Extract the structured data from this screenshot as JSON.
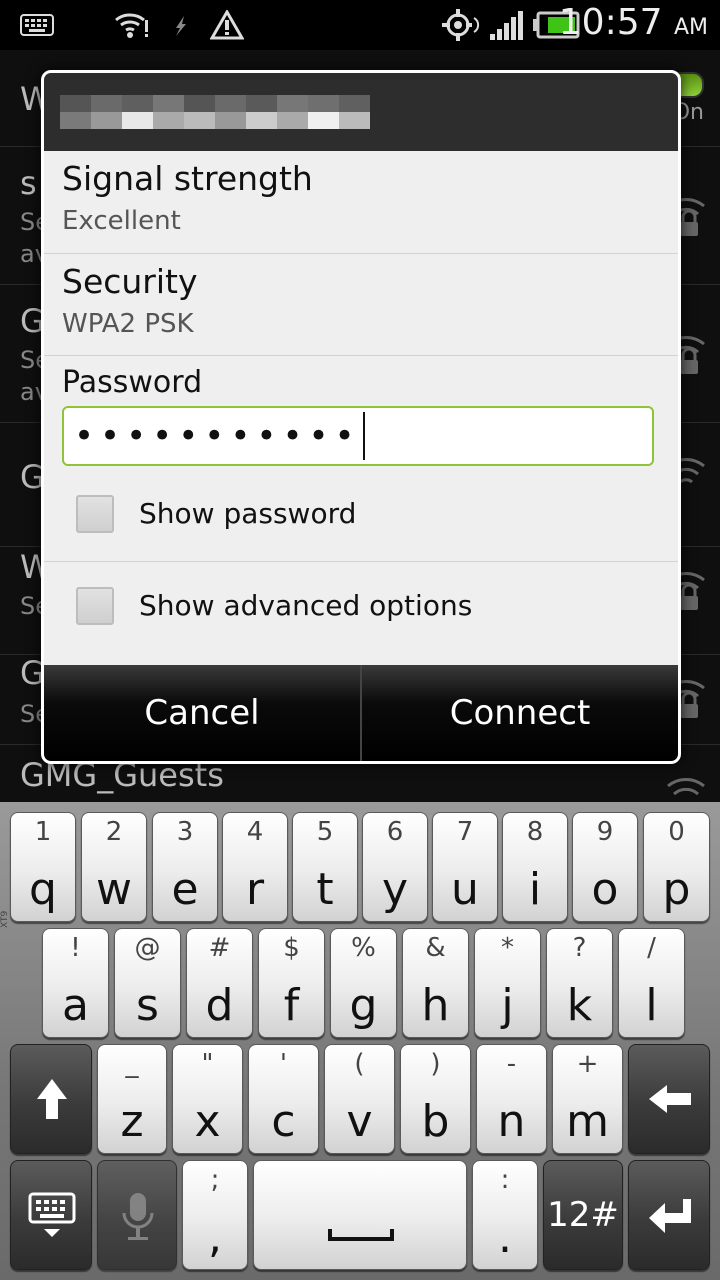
{
  "status_bar": {
    "time": "10:57",
    "ampm": "AM",
    "icons": [
      "keyboard-icon",
      "wifi-icon",
      "usb-debug-icon",
      "warning-icon",
      "gps-icon",
      "signal-icon",
      "battery-icon"
    ]
  },
  "background_list": {
    "toggle_label": "On",
    "rows": [
      {
        "ssid": "W",
        "sub": ""
      },
      {
        "ssid": "s",
        "sub": "Se",
        "sub2": "av"
      },
      {
        "ssid": "G",
        "sub": "Se",
        "sub2": "av"
      },
      {
        "ssid": "GM",
        "sub": ""
      },
      {
        "ssid": "W",
        "sub": "Se"
      },
      {
        "ssid": "G",
        "sub": "Se"
      },
      {
        "ssid": "GMG_Guests",
        "sub": ""
      }
    ]
  },
  "dialog": {
    "signal_label": "Signal strength",
    "signal_value": "Excellent",
    "security_label": "Security",
    "security_value": "WPA2 PSK",
    "password_label": "Password",
    "password_value": "•••••••••••",
    "show_password_label": "Show password",
    "show_advanced_label": "Show advanced options",
    "cancel_label": "Cancel",
    "connect_label": "Connect"
  },
  "keyboard": {
    "row1": [
      {
        "num": "1",
        "ch": "q"
      },
      {
        "num": "2",
        "ch": "w"
      },
      {
        "num": "3",
        "ch": "e"
      },
      {
        "num": "4",
        "ch": "r"
      },
      {
        "num": "5",
        "ch": "t"
      },
      {
        "num": "6",
        "ch": "y"
      },
      {
        "num": "7",
        "ch": "u"
      },
      {
        "num": "8",
        "ch": "i"
      },
      {
        "num": "9",
        "ch": "o"
      },
      {
        "num": "0",
        "ch": "p"
      }
    ],
    "row2": [
      {
        "num": "!",
        "ch": "a"
      },
      {
        "num": "@",
        "ch": "s"
      },
      {
        "num": "#",
        "ch": "d"
      },
      {
        "num": "$",
        "ch": "f"
      },
      {
        "num": "%",
        "ch": "g"
      },
      {
        "num": "&",
        "ch": "h"
      },
      {
        "num": "*",
        "ch": "j"
      },
      {
        "num": "?",
        "ch": "k"
      },
      {
        "num": "/",
        "ch": "l"
      }
    ],
    "row3": [
      {
        "num": "_",
        "ch": "z"
      },
      {
        "num": "\"",
        "ch": "x"
      },
      {
        "num": "'",
        "ch": "c"
      },
      {
        "num": "(",
        "ch": "v"
      },
      {
        "num": ")",
        "ch": "b"
      },
      {
        "num": "-",
        "ch": "n"
      },
      {
        "num": "+",
        "ch": "m"
      }
    ],
    "comma_top": ";",
    "comma": ",",
    "period_top": ":",
    "period": ".",
    "symbols_label": "12#",
    "side_label": "XT9"
  }
}
